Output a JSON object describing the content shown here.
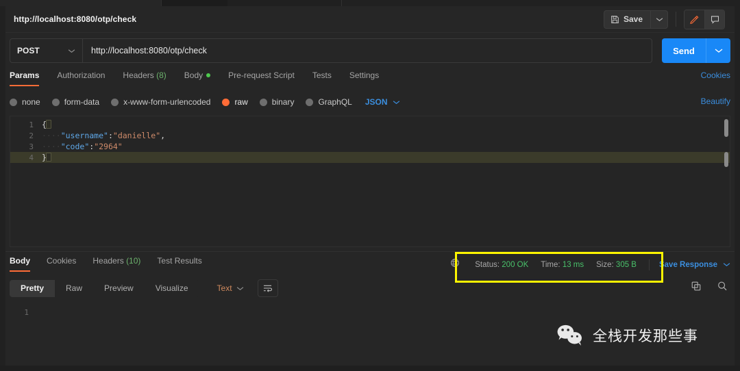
{
  "request": {
    "name": "http://localhost:8080/otp/check",
    "method": "POST",
    "url": "http://localhost:8080/otp/check",
    "send_label": "Send",
    "save_label": "Save",
    "tabs": [
      {
        "label": "Params",
        "count": "",
        "active": false,
        "dot": false
      },
      {
        "label": "Authorization",
        "count": "",
        "active": false,
        "dot": false
      },
      {
        "label": "Headers",
        "count": "(8)",
        "active": false,
        "dot": false
      },
      {
        "label": "Body",
        "count": "",
        "active": true,
        "dot": true
      },
      {
        "label": "Pre-request Script",
        "count": "",
        "active": false,
        "dot": false
      },
      {
        "label": "Tests",
        "count": "",
        "active": false,
        "dot": false
      },
      {
        "label": "Settings",
        "count": "",
        "active": false,
        "dot": false
      }
    ],
    "cookies_link": "Cookies",
    "beautify_link": "Beautify",
    "body_types": [
      {
        "label": "none",
        "selected": false
      },
      {
        "label": "form-data",
        "selected": false
      },
      {
        "label": "x-www-form-urlencoded",
        "selected": false
      },
      {
        "label": "raw",
        "selected": true
      },
      {
        "label": "binary",
        "selected": false
      },
      {
        "label": "GraphQL",
        "selected": false
      }
    ],
    "format_selected": "JSON",
    "body_lines": [
      {
        "n": "1",
        "text": "{",
        "current": false
      },
      {
        "n": "2",
        "text": "    \"username\":\"danielle\",",
        "current": false
      },
      {
        "n": "3",
        "text": "    \"code\":\"2964\"",
        "current": false
      },
      {
        "n": "4",
        "text": "}",
        "current": true
      }
    ],
    "body_json": {
      "username": "danielle",
      "code": "2964"
    }
  },
  "response": {
    "tabs": [
      {
        "label": "Body",
        "count": "",
        "active": true
      },
      {
        "label": "Cookies",
        "count": "",
        "active": false
      },
      {
        "label": "Headers",
        "count": "(10)",
        "active": false
      },
      {
        "label": "Test Results",
        "count": "",
        "active": false
      }
    ],
    "status_label": "Status:",
    "status_value": "200 OK",
    "time_label": "Time:",
    "time_value": "13 ms",
    "size_label": "Size:",
    "size_value": "305 B",
    "save_response": "Save Response",
    "view_modes": [
      {
        "label": "Pretty",
        "active": true
      },
      {
        "label": "Raw",
        "active": false
      },
      {
        "label": "Preview",
        "active": false
      },
      {
        "label": "Visualize",
        "active": false
      }
    ],
    "format_selected": "Text",
    "body_lines": [
      {
        "n": "1",
        "text": ""
      }
    ]
  },
  "watermark": {
    "text": "全栈开发那些事"
  },
  "colors": {
    "accent_orange": "#ff6c37",
    "send_blue": "#1988f7",
    "link_blue": "#3b8ede",
    "status_green": "#49c16a",
    "highlight_yellow": "#fdf500",
    "background": "#262626"
  }
}
